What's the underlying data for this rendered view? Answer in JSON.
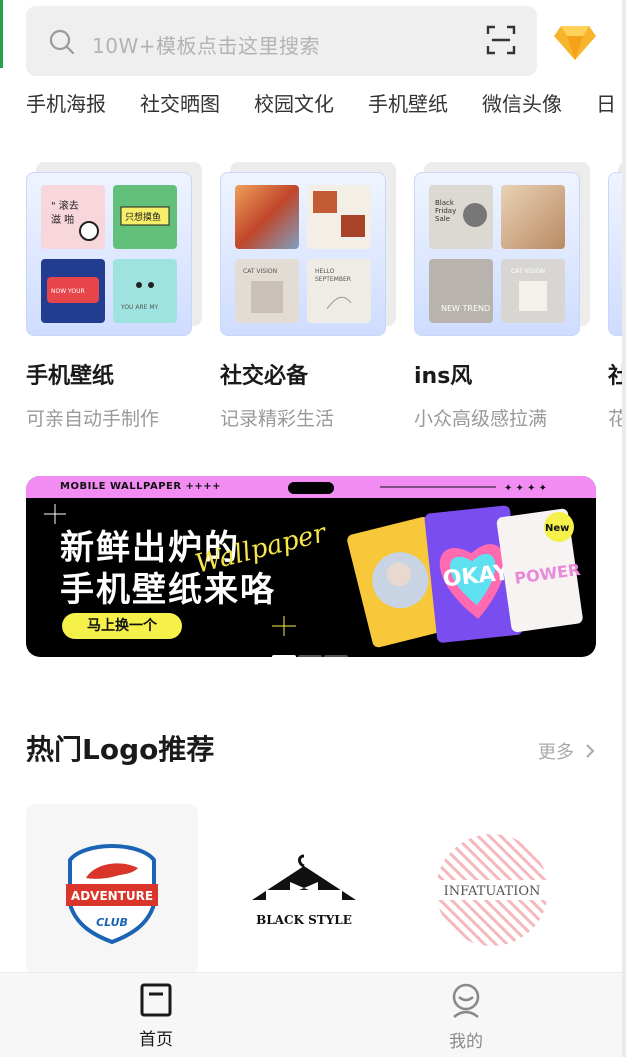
{
  "search": {
    "placeholder": "10W+模板点击这里搜索"
  },
  "categories": [
    "手机海报",
    "社交晒图",
    "校园文化",
    "手机壁纸",
    "微信头像",
    "日"
  ],
  "cards": [
    {
      "title": "手机壁纸",
      "subtitle": "可亲自动手制作"
    },
    {
      "title": "社交必备",
      "subtitle": "记录精彩生活"
    },
    {
      "title": "ins风",
      "subtitle": "小众高级感拉满"
    },
    {
      "title": "社",
      "subtitle": "花"
    }
  ],
  "banner": {
    "tag": "MOBILE WALLPAPER ++++",
    "line1": "新鲜出炉的",
    "line2": "手机壁纸来咯",
    "script": "Wallpaper",
    "cta": "马上换一个"
  },
  "section": {
    "title": "热门Logo推荐",
    "more": "更多"
  },
  "logos": [
    {
      "line1": "ADVENTURE",
      "line2": "CLUB"
    },
    {
      "name": "BLACK STYLE"
    },
    {
      "name": "INFATUATION"
    }
  ],
  "nav": {
    "home": "首页",
    "me": "我的"
  },
  "colors": {
    "accent": "#1a1a1a",
    "banner_pink": "#f28cf2",
    "cta_yellow": "#f5f04a"
  }
}
